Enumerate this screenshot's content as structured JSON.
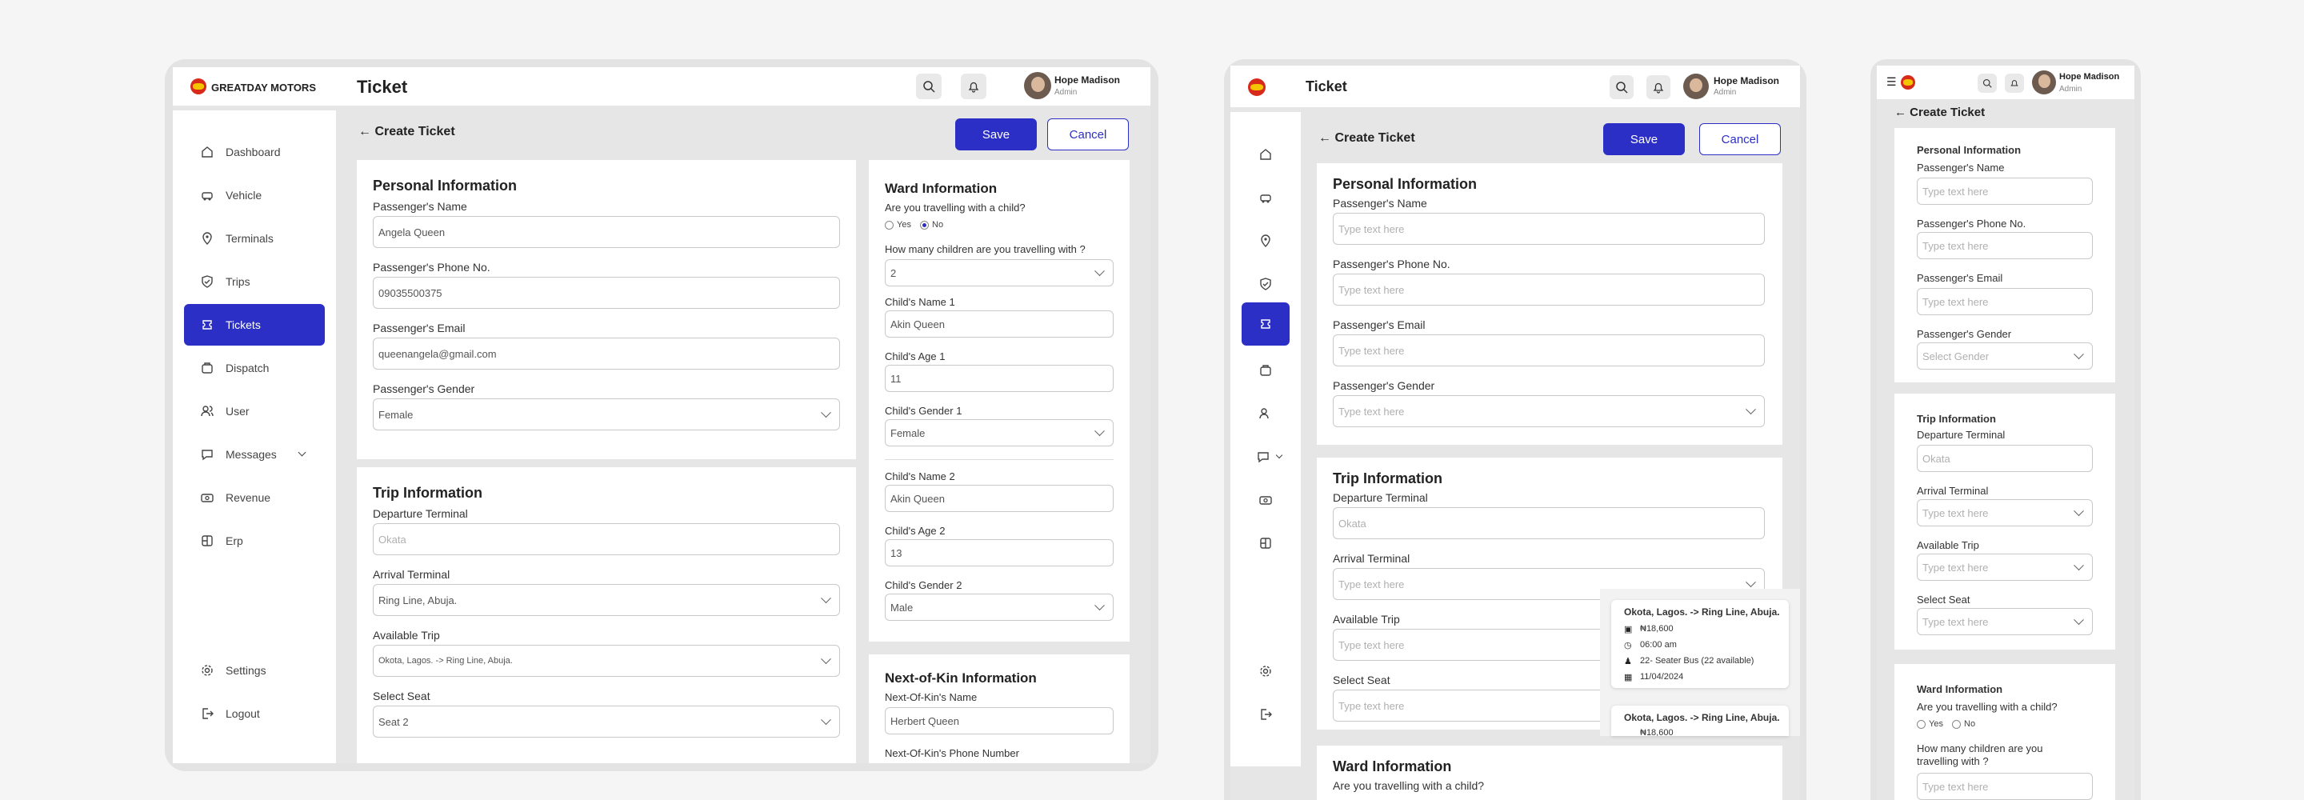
{
  "brand": {
    "name": "GREATDAY MOTORS"
  },
  "page_title": "Ticket",
  "user": {
    "name": "Hope Madison",
    "role": "Admin"
  },
  "back_title": "Create Ticket",
  "actions": {
    "save": "Save",
    "cancel": "Cancel"
  },
  "nav": {
    "items": [
      {
        "label": "Dashboard",
        "icon": "home-icon"
      },
      {
        "label": "Vehicle",
        "icon": "car-icon"
      },
      {
        "label": "Terminals",
        "icon": "location-pin-icon"
      },
      {
        "label": "Trips",
        "icon": "shield-check-icon"
      },
      {
        "label": "Tickets",
        "icon": "ticket-icon",
        "active": true
      },
      {
        "label": "Dispatch",
        "icon": "dispatch-icon"
      },
      {
        "label": "User",
        "icon": "users-icon"
      },
      {
        "label": "Messages",
        "icon": "message-icon"
      },
      {
        "label": "Revenue",
        "icon": "revenue-icon"
      },
      {
        "label": "Erp",
        "icon": "erp-icon"
      }
    ],
    "settings": "Settings",
    "logout": "Logout"
  },
  "personal": {
    "heading": "Personal Information",
    "name_label": "Passenger's Name",
    "phone_label": "Passenger's Phone No.",
    "email_label": "Passenger's Email",
    "gender_label": "Passenger's Gender",
    "name": "Angela Queen",
    "phone": "09035500375",
    "email": "queenangela@gmail.com",
    "gender": "Female"
  },
  "trip": {
    "heading": "Trip Information",
    "departure_label": "Departure Terminal",
    "arrival_label": "Arrival Terminal",
    "available_label": "Available Trip",
    "seat_label": "Select Seat",
    "departure": "Okata",
    "arrival": "Ring Line, Abuja.",
    "available": "Okota, Lagos. -> Ring Line, Abuja.",
    "seat": "Seat 2"
  },
  "ward": {
    "heading": "Ward Information",
    "question": "Are you travelling with a child?",
    "yes": "Yes",
    "no": "No",
    "count_label": "How many children are you travelling with ?",
    "count_label_wrapped_1": "How many children are you",
    "count_label_wrapped_2": "travelling with ?",
    "count": "2",
    "children": [
      {
        "name_label": "Child's Name 1",
        "name": "Akin Queen",
        "age_label": "Child's Age 1",
        "age": "11",
        "gender_label": "Child's Gender 1",
        "gender": "Female"
      },
      {
        "name_label": "Child's Name 2",
        "name": "Akin Queen",
        "age_label": "Child's Age 2",
        "age": "13",
        "gender_label": "Child's Gender 2",
        "gender": "Male"
      }
    ]
  },
  "kin": {
    "heading": "Next-of-Kin Information",
    "name_label": "Next-Of-Kin's Name",
    "name": "Herbert Queen",
    "phone_label": "Next-Of-Kin's Phone Number"
  },
  "placeholders": {
    "text": "Type text here",
    "gender": "Select Gender",
    "departure": "Okata"
  },
  "trip_popup": {
    "route": "Okota, Lagos. -> Ring Line, Abuja.",
    "price": "₦18,600",
    "time": "06:00 am",
    "bus": "22- Seater Bus (22 available)",
    "date": "11/04/2024",
    "route2": "Okota, Lagos. -> Ring Line, Abuja.",
    "price2": "₦18,600"
  },
  "colors": {
    "accent": "#2b2fc6",
    "brand_red": "#d72a1b",
    "brand_yellow": "#f5c400"
  }
}
